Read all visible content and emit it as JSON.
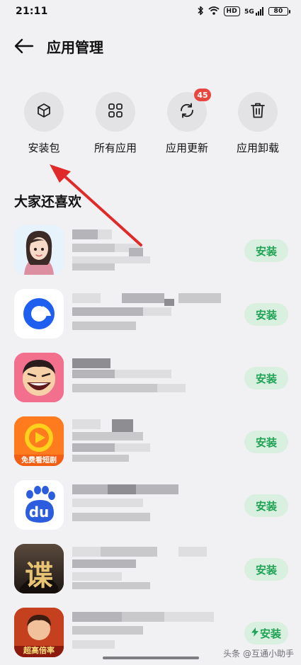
{
  "status_bar": {
    "time": "21:11",
    "hd_label": "HD",
    "network_label": "5G",
    "battery": "80"
  },
  "header": {
    "title": "应用管理"
  },
  "actions": [
    {
      "label": "安装包",
      "icon": "cube-icon"
    },
    {
      "label": "所有应用",
      "icon": "grid-icon"
    },
    {
      "label": "应用更新",
      "icon": "refresh-icon",
      "badge": "45"
    },
    {
      "label": "应用卸载",
      "icon": "trash-icon"
    }
  ],
  "section": {
    "title": "大家还喜欢"
  },
  "apps": [
    {
      "icon": "avatar-girl-icon",
      "install_label": "安装"
    },
    {
      "icon": "blue-ring-icon",
      "install_label": "安装"
    },
    {
      "icon": "laughing-face-icon",
      "install_label": "安装"
    },
    {
      "icon": "orange-play-icon",
      "icon_caption": "免费看短剧",
      "install_label": "安装"
    },
    {
      "icon": "baidu-paw-icon",
      "icon_text": "du",
      "install_label": "安装"
    },
    {
      "icon": "game-dark-icon",
      "icon_text": "谍",
      "install_label": "安装"
    },
    {
      "icon": "game-hero-icon",
      "icon_caption": "超高倍率",
      "install_label": "安装",
      "fast_install": true
    }
  ],
  "watermark": "头条 @互通小助手",
  "colors": {
    "background": "#f1f1f3",
    "install_green": "#1fa354",
    "install_bg": "#d9efe0",
    "badge_red": "#e8473f",
    "annotation_red": "#e02a2a"
  }
}
